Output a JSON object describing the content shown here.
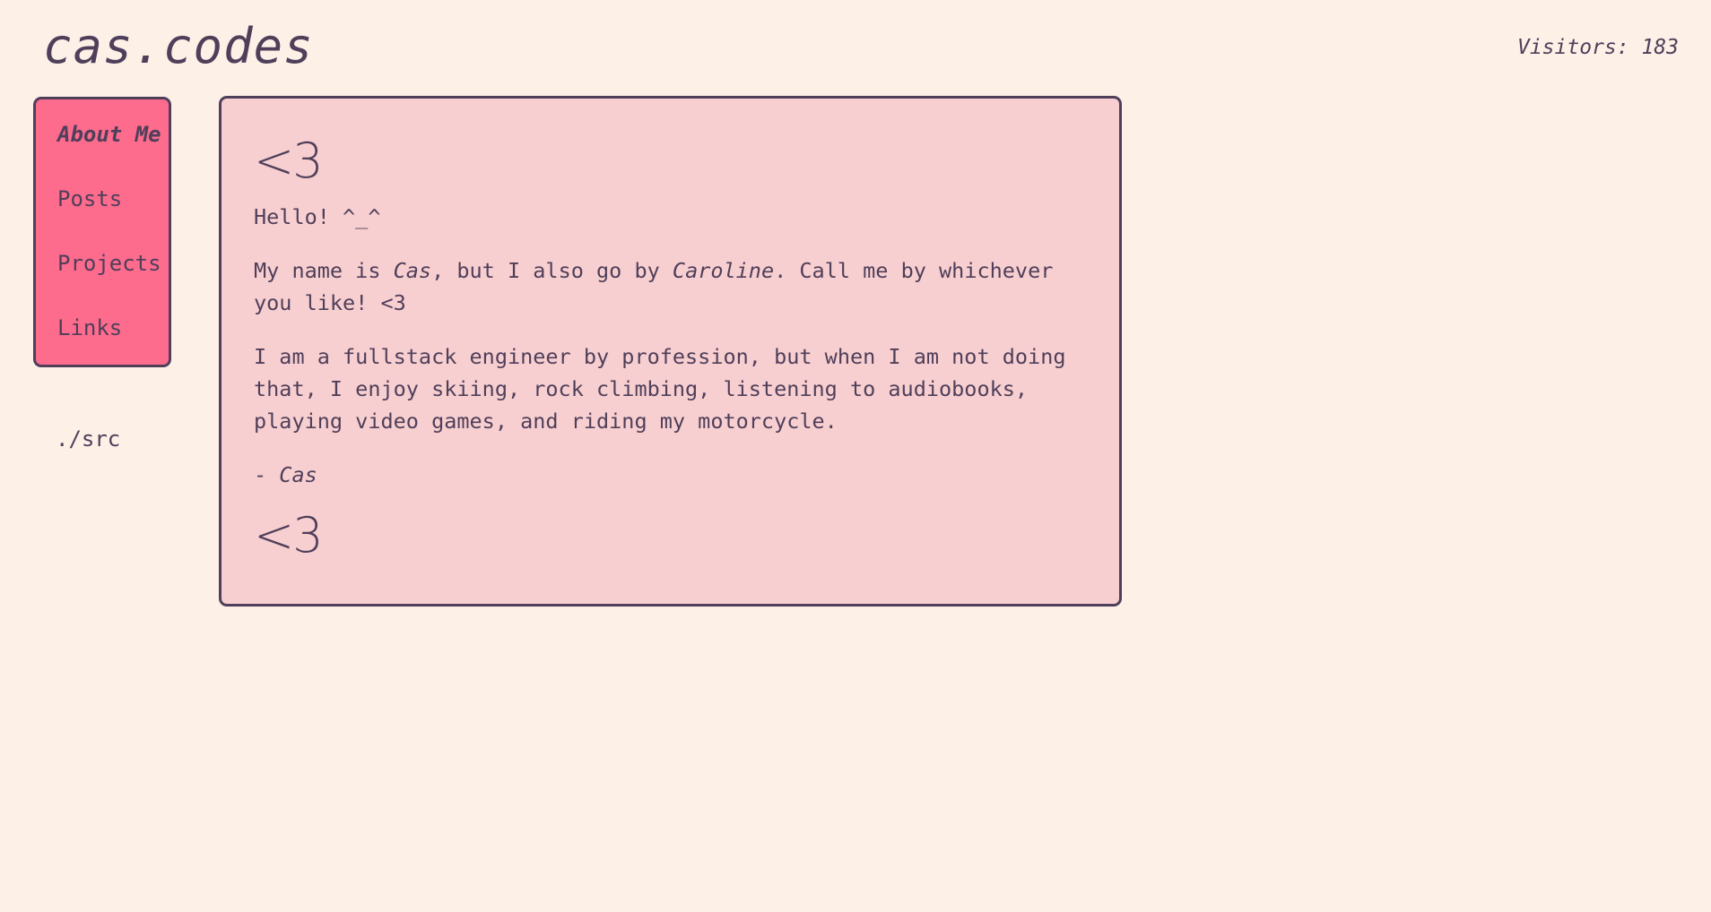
{
  "header": {
    "title": "cas.codes",
    "visitors": "Visitors: 183"
  },
  "sidebar": {
    "items": [
      {
        "label": "About Me",
        "active": true
      },
      {
        "label": "Posts",
        "active": false
      },
      {
        "label": "Projects",
        "active": false
      },
      {
        "label": "Links",
        "active": false
      }
    ],
    "src_link": "./src"
  },
  "content": {
    "heading_top": "<3",
    "greeting": "Hello! ^_^",
    "intro": {
      "part1": "My name is ",
      "name1": "Cas",
      "part2": ", but I also go by ",
      "name2": "Caroline",
      "part3": ". Call me by whichever you like! <3"
    },
    "bio": "I am a fullstack engineer by profession, but when I am not doing that, I enjoy skiing, rock climbing, listening to audiobooks, playing video games, and riding my motorcycle.",
    "signature": {
      "dash": "- ",
      "name": "Cas"
    },
    "heading_bottom": "<3"
  },
  "colors": {
    "background": "#fcf0e7",
    "text": "#4f3f5a",
    "sidebar": "#fd6b8d",
    "card": "#f8cfd0",
    "border": "#4f3f5a"
  }
}
